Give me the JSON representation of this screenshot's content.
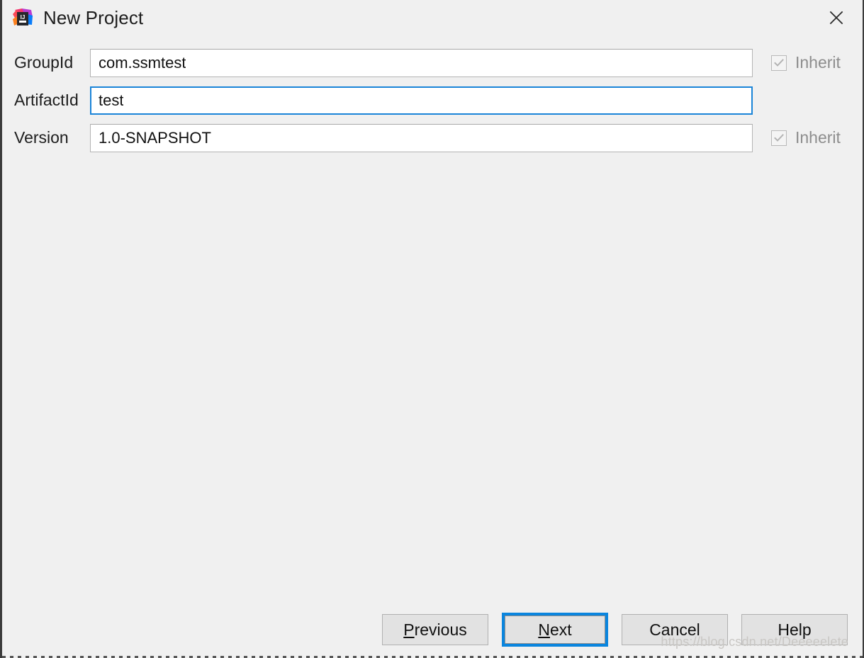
{
  "window": {
    "title": "New Project",
    "icon": "intellij-idea-icon",
    "close_icon": "close-icon",
    "background_color": "#f0f0f0",
    "border_color": "#3b3b3b"
  },
  "form": {
    "rows": [
      {
        "label": "GroupId",
        "value": "com.ssmtest",
        "focused": false,
        "has_inherit": true,
        "inherit_label": "Inherit",
        "inherit_checked": true,
        "inherit_disabled": true
      },
      {
        "label": "ArtifactId",
        "value": "test",
        "focused": true,
        "has_inherit": false,
        "inherit_label": "",
        "inherit_checked": false,
        "inherit_disabled": false
      },
      {
        "label": "Version",
        "value": "1.0-SNAPSHOT",
        "focused": false,
        "has_inherit": true,
        "inherit_label": "Inherit",
        "inherit_checked": true,
        "inherit_disabled": true
      }
    ],
    "focus_color": "#1a84d8"
  },
  "buttons": {
    "previous": {
      "label": "Previous",
      "mnemonic": "P",
      "default": false
    },
    "next": {
      "label": "Next",
      "mnemonic": "N",
      "default": true
    },
    "cancel": {
      "label": "Cancel",
      "mnemonic": "",
      "default": false
    },
    "help": {
      "label": "Help",
      "mnemonic": "",
      "default": false
    },
    "default_ring_color": "#0a85de"
  },
  "watermark": {
    "text": "https://blog.csdn.net/Deeeeelete"
  }
}
